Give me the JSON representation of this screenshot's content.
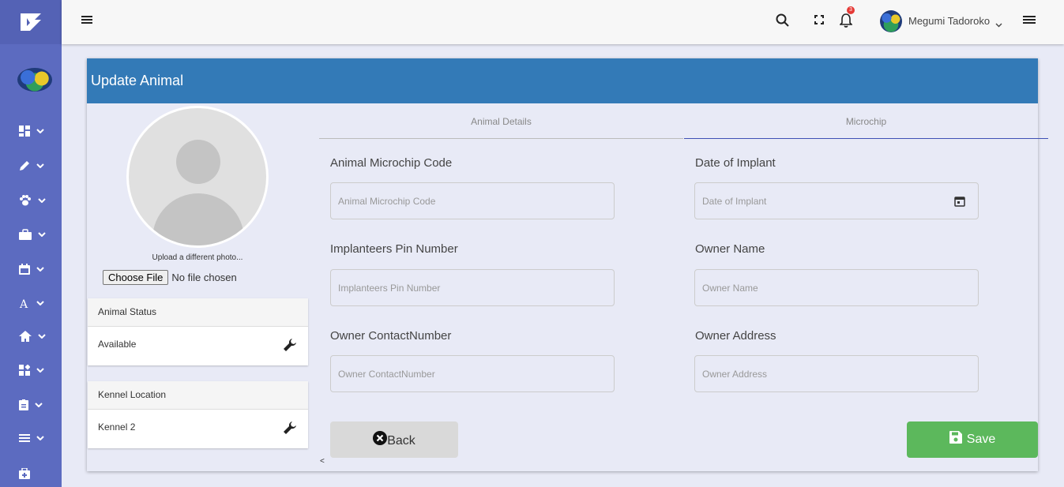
{
  "topbar": {
    "user_name": "Megumi Tadoroko",
    "notification_count": "3"
  },
  "card": {
    "title": "Update Animal"
  },
  "photo": {
    "upload_text": "Upload a different photo...",
    "choose_file_label": "Choose File",
    "no_file_text": "No file chosen"
  },
  "status_panel": {
    "title": "Animal Status",
    "value": "Available"
  },
  "kennel_panel": {
    "title": "Kennel Location",
    "value": "Kennel 2"
  },
  "tabs": [
    {
      "label": "Animal Details"
    },
    {
      "label": "Microchip"
    }
  ],
  "form": {
    "microchip_code": {
      "label": "Animal Microchip Code",
      "placeholder": "Animal Microchip Code"
    },
    "date_of_implant": {
      "label": "Date of Implant",
      "placeholder": "Date of Implant"
    },
    "pin_number": {
      "label": "Implanteers Pin Number",
      "placeholder": "Implanteers Pin Number"
    },
    "owner_name": {
      "label": "Owner Name",
      "placeholder": "Owner Name"
    },
    "owner_contact": {
      "label": "Owner ContactNumber",
      "placeholder": "Owner ContactNumber"
    },
    "owner_address": {
      "label": "Owner Address",
      "placeholder": "Owner Address"
    }
  },
  "buttons": {
    "back_label": "Back",
    "save_label": "Save"
  },
  "misc": {
    "scroll_arrow": "<"
  },
  "colors": {
    "sidebar": "#5c6bc0",
    "header": "#337ab7",
    "save": "#5cb85c",
    "active_tab": "#3f51b5"
  },
  "sidebar_icons": [
    "dashboard-icon",
    "pencil-icon",
    "paw-icon",
    "briefcase-icon",
    "calendar-icon",
    "font-icon",
    "home-icon",
    "widgets-icon",
    "clipboard-icon",
    "list-icon",
    "plus-case-icon"
  ]
}
